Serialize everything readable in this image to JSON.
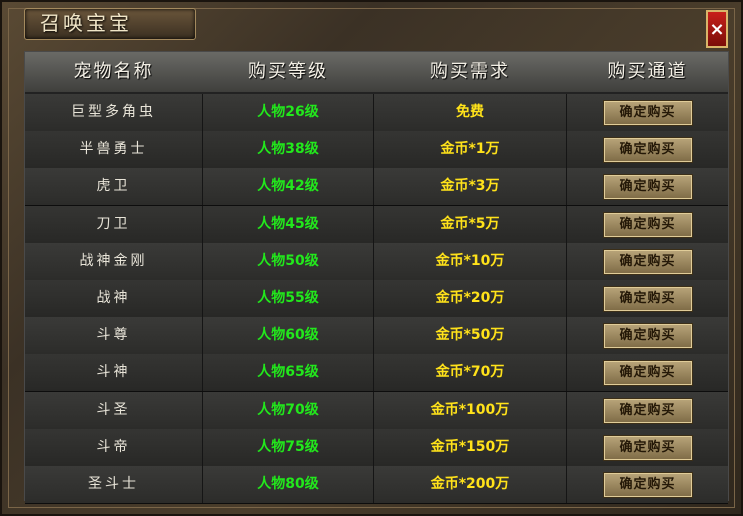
{
  "window": {
    "title": "召唤宝宝",
    "close_label": "×"
  },
  "table": {
    "headers": [
      "宠物名称",
      "购买等级",
      "购买需求",
      "购买通道"
    ],
    "rows": [
      {
        "name": "巨型多角虫",
        "level": "人物26级",
        "cost": "免费",
        "button": "确定购买"
      },
      {
        "name": "半兽勇士",
        "level": "人物38级",
        "cost": "金币*1万",
        "button": "确定购买"
      },
      {
        "name": "虎卫",
        "level": "人物42级",
        "cost": "金币*3万",
        "button": "确定购买"
      },
      {
        "name": "刀卫",
        "level": "人物45级",
        "cost": "金币*5万",
        "button": "确定购买"
      },
      {
        "name": "战神金刚",
        "level": "人物50级",
        "cost": "金币*10万",
        "button": "确定购买"
      },
      {
        "name": "战神",
        "level": "人物55级",
        "cost": "金币*20万",
        "button": "确定购买"
      },
      {
        "name": "斗尊",
        "level": "人物60级",
        "cost": "金币*50万",
        "button": "确定购买"
      },
      {
        "name": "斗神",
        "level": "人物65级",
        "cost": "金币*70万",
        "button": "确定购买"
      },
      {
        "name": "斗圣",
        "level": "人物70级",
        "cost": "金币*100万",
        "button": "确定购买"
      },
      {
        "name": "斗帝",
        "level": "人物75级",
        "cost": "金币*150万",
        "button": "确定购买"
      },
      {
        "name": "圣斗士",
        "level": "人物80级",
        "cost": "金币*200万",
        "button": "确定购买"
      }
    ]
  },
  "colors": {
    "level": "#22e81c",
    "cost": "#ffe21a",
    "close": "#c8201a"
  }
}
